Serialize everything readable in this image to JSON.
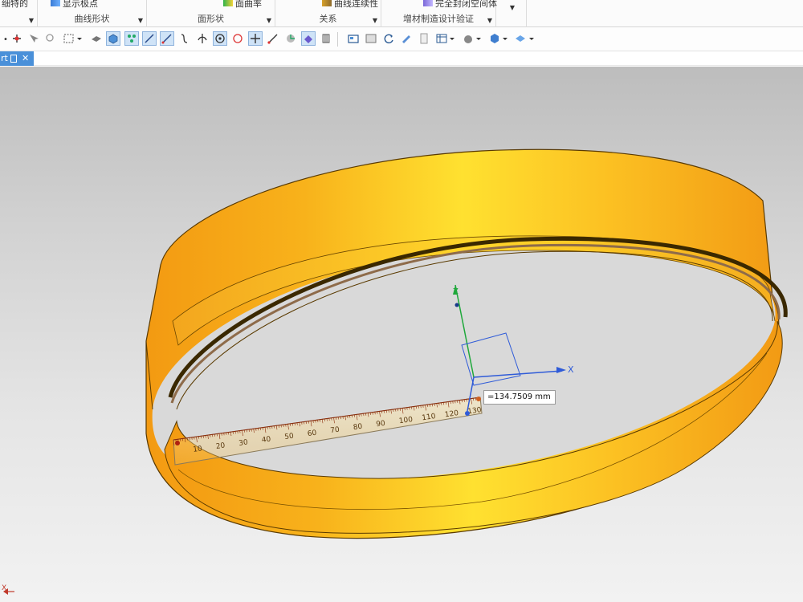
{
  "ribbon": {
    "groups": [
      {
        "top": "细特的",
        "label": ""
      },
      {
        "top": "显示极点",
        "label": "曲线形状"
      },
      {
        "top": "面曲率",
        "label": "面形状"
      },
      {
        "top": "曲线连续性",
        "label": "关系"
      },
      {
        "top": "完全封闭空间体",
        "label": "增材制造设计验证"
      }
    ]
  },
  "tab": {
    "label": "rt",
    "close": "✕"
  },
  "viewport": {
    "part_color": "#f7a51c",
    "axis_x_label": "X",
    "axis_z_label": "Z",
    "measure_value": "=134.7509 mm",
    "ruler_ticks": [
      "10",
      "20",
      "30",
      "40",
      "50",
      "60",
      "70",
      "80",
      "90",
      "100",
      "110",
      "120",
      "130"
    ],
    "triad_label": "X"
  },
  "colors": {
    "accent": "#4a90d9",
    "part": "#f7a51c",
    "axis_x": "#2f5bd8",
    "axis_z": "#1fa83b"
  }
}
